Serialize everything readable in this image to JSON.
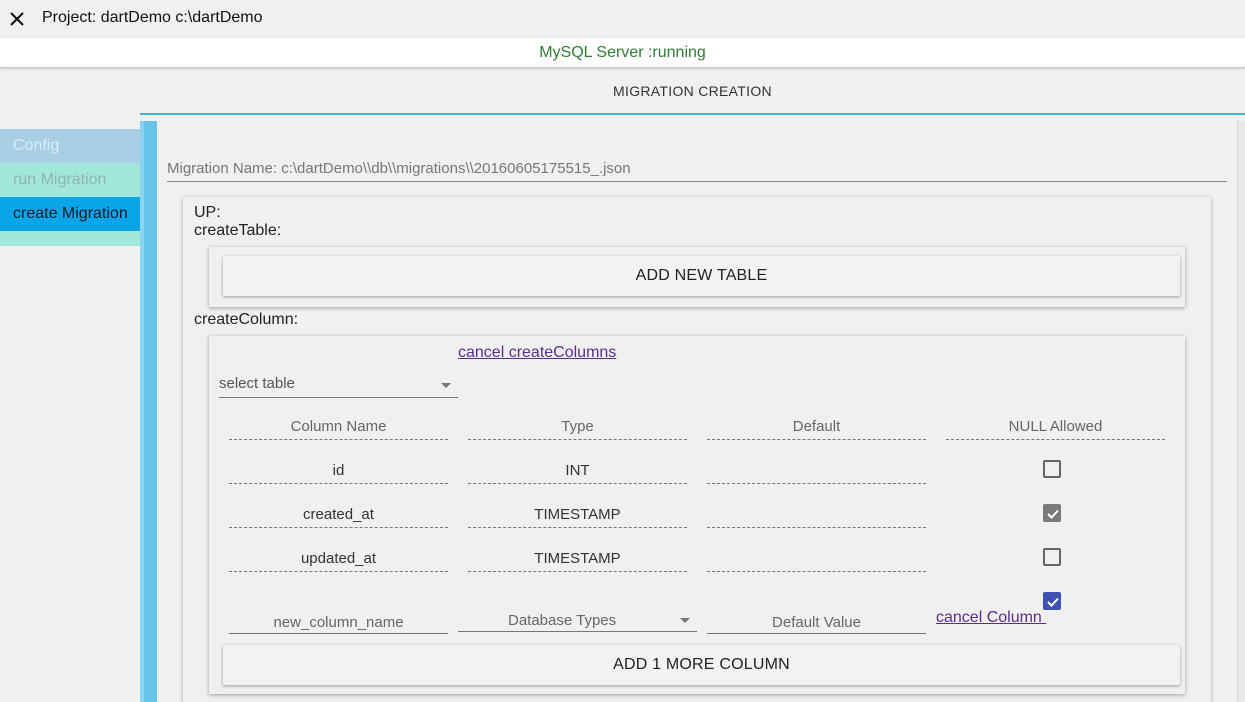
{
  "window": {
    "title": "Project: dartDemo c:\\dartDemo"
  },
  "status": {
    "text": "MySQL Server :running",
    "color": "#2e7d32"
  },
  "header": {
    "title": "MIGRATION CREATION"
  },
  "sidebar": {
    "items": [
      {
        "label": "Config"
      },
      {
        "label": "run Migration"
      },
      {
        "label": "create Migration",
        "active": true
      }
    ]
  },
  "migration": {
    "name": "Migration Name: c:\\dartDemo\\\\db\\\\migrations\\\\20160605175515_.json"
  },
  "up": {
    "up_label": "UP:",
    "create_table_label": "createTable:",
    "add_table_button": "ADD NEW TABLE",
    "create_column_label": "createColumn:",
    "cancel_create_columns": "cancel createColumns",
    "select_table_placeholder": "select table",
    "columns_header": [
      "Column Name",
      "Type",
      "Default",
      "NULL Allowed"
    ],
    "rows": [
      {
        "name": "id",
        "type": "INT",
        "default": "",
        "null_allowed": false
      },
      {
        "name": "created_at",
        "type": "TIMESTAMP",
        "default": "",
        "null_allowed": true
      },
      {
        "name": "updated_at",
        "type": "TIMESTAMP",
        "default": "",
        "null_allowed": false
      }
    ],
    "new_column": {
      "name_placeholder": "new_column_name",
      "type_placeholder": "Database Types",
      "default_placeholder": "Default Value",
      "null_allowed": true,
      "cancel_label": "cancel Column "
    },
    "add_column_button": "ADD 1 MORE COLUMN"
  },
  "colors": {
    "accent": "#0aa4e9",
    "checkbox_checked": "#3f51b5",
    "link": "#5b2d8e"
  }
}
